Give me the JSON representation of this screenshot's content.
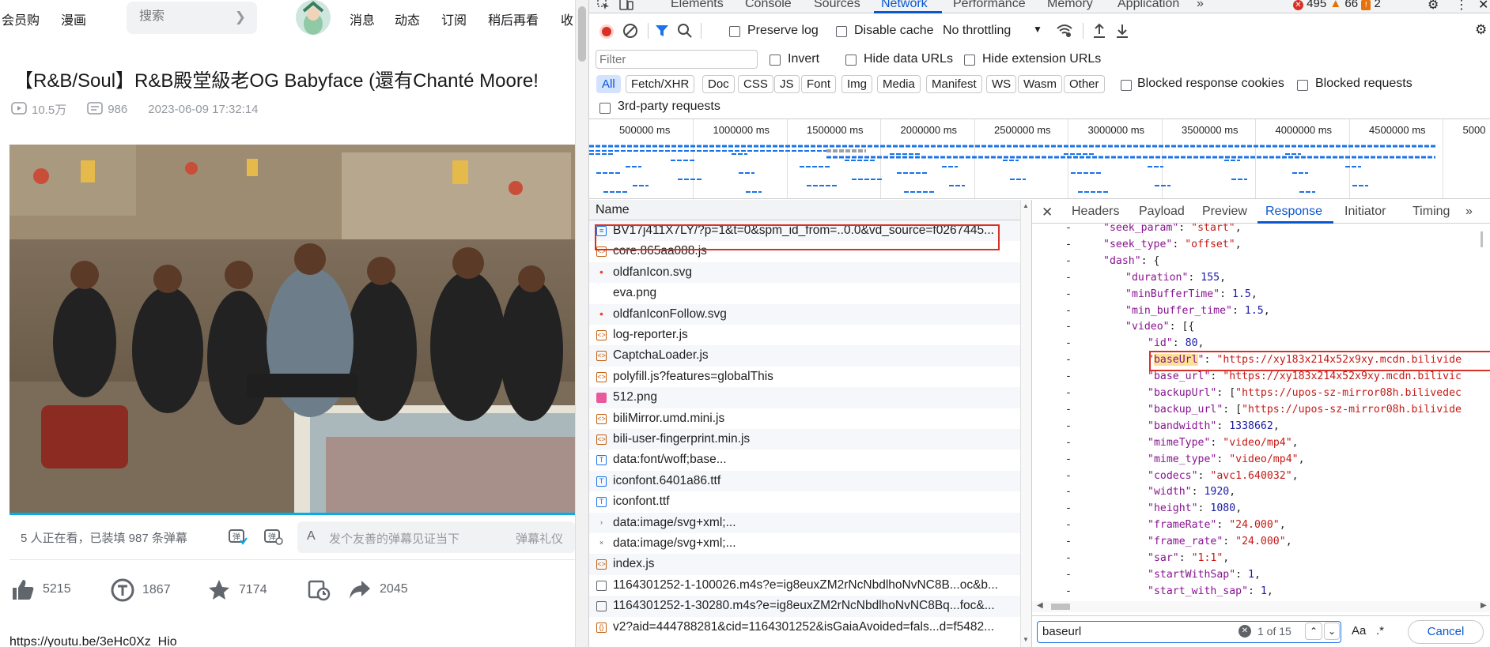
{
  "bili": {
    "nav": {
      "vip": "会员购",
      "comic": "漫画",
      "message": "消息",
      "dynamic": "动态",
      "subscribe": "订阅",
      "watch_later": "稍后再看",
      "fav": "收"
    },
    "search_placeholder": "搜索",
    "video": {
      "title": "【R&B/Soul】R&B殿堂級老OG Babyface (還有Chanté Moore!",
      "views": "10.5万",
      "danmaku_count": "986",
      "date": "2023-06-09 17:32:14"
    },
    "danmu_bar": {
      "watching": "5 人正在看，已装填 987 条弹幕",
      "input_placeholder": "发个友善的弹幕见证当下",
      "etiquette": "弹幕礼仪"
    },
    "actions": {
      "like": "5215",
      "coin": "1867",
      "fav": "7174",
      "share": "2045"
    },
    "desc_url": "https://youtu.be/3eHc0Xz_Hio"
  },
  "devtools": {
    "tabs": [
      "Elements",
      "Console",
      "Sources",
      "Network",
      "Performance",
      "Memory",
      "Application"
    ],
    "selected_tab": "Network",
    "counts": {
      "errors": "495",
      "warnings": "66",
      "issues": "2"
    },
    "toolbar": {
      "preserve_log": "Preserve log",
      "disable_cache": "Disable cache",
      "throttling": "No throttling"
    },
    "filter": {
      "placeholder": "Filter",
      "invert": "Invert",
      "hide_data": "Hide data URLs",
      "hide_ext": "Hide extension URLs"
    },
    "types": [
      "All",
      "Fetch/XHR",
      "Doc",
      "CSS",
      "JS",
      "Font",
      "Img",
      "Media",
      "Manifest",
      "WS",
      "Wasm",
      "Other"
    ],
    "blocked_cookies": "Blocked response cookies",
    "blocked_requests": "Blocked requests",
    "third_party": "3rd-party requests",
    "timeline_ticks": [
      "500000 ms",
      "1000000 ms",
      "1500000 ms",
      "2000000 ms",
      "2500000 ms",
      "3000000 ms",
      "3500000 ms",
      "4000000 ms",
      "4500000 ms",
      "5000"
    ],
    "name_header": "Name",
    "requests": [
      {
        "name": "BV17j411X7LY/?p=1&t=0&spm_id_from=..0.0&vd_source=f0267445...",
        "type": "doc"
      },
      {
        "name": "core.865aa088.js",
        "type": "js"
      },
      {
        "name": "oldfanIcon.svg",
        "type": "dot"
      },
      {
        "name": "eva.png",
        "type": "none"
      },
      {
        "name": "oldfanIconFollow.svg",
        "type": "dot"
      },
      {
        "name": "log-reporter.js",
        "type": "js"
      },
      {
        "name": "CaptchaLoader.js",
        "type": "js"
      },
      {
        "name": "polyfill.js?features=globalThis",
        "type": "js"
      },
      {
        "name": "512.png",
        "type": "img"
      },
      {
        "name": "biliMirror.umd.mini.js",
        "type": "js"
      },
      {
        "name": "bili-user-fingerprint.min.js",
        "type": "js"
      },
      {
        "name": "data:font/woff;base...",
        "type": "font"
      },
      {
        "name": "iconfont.6401a86.ttf",
        "type": "font"
      },
      {
        "name": "iconfont.ttf",
        "type": "font"
      },
      {
        "name": "data:image/svg+xml;...",
        "type": "chev"
      },
      {
        "name": "data:image/svg+xml;...",
        "type": "x"
      },
      {
        "name": "index.js",
        "type": "js"
      },
      {
        "name": "1164301252-1-100026.m4s?e=ig8euxZM2rNcNbdlhoNvNC8B...oc&b...",
        "type": "plain"
      },
      {
        "name": "1164301252-1-30280.m4s?e=ig8euxZM2rNcNbdlhoNvNC8Bq...foc&...",
        "type": "plain"
      },
      {
        "name": "v2?aid=444788281&cid=1164301252&isGaiaAvoided=fals...d=f5482...",
        "type": "xhr"
      }
    ],
    "detail_tabs": [
      "Headers",
      "Payload",
      "Preview",
      "Response",
      "Initiator",
      "Timing"
    ],
    "selected_detail": "Response",
    "code_lines": [
      {
        "indent": 3,
        "parts": [
          [
            "k",
            "\"seek_param\""
          ],
          [
            "p",
            ": "
          ],
          [
            "s",
            "\"start\""
          ],
          [
            "p",
            ","
          ]
        ]
      },
      {
        "indent": 3,
        "parts": [
          [
            "k",
            "\"seek_type\""
          ],
          [
            "p",
            ": "
          ],
          [
            "s",
            "\"offset\""
          ],
          [
            "p",
            ","
          ]
        ]
      },
      {
        "indent": 3,
        "parts": [
          [
            "k",
            "\"dash\""
          ],
          [
            "p",
            ": {"
          ]
        ]
      },
      {
        "indent": 4,
        "parts": [
          [
            "k",
            "\"duration\""
          ],
          [
            "p",
            ": "
          ],
          [
            "n",
            "155"
          ],
          [
            "p",
            ","
          ]
        ]
      },
      {
        "indent": 4,
        "parts": [
          [
            "k",
            "\"minBufferTime\""
          ],
          [
            "p",
            ": "
          ],
          [
            "n",
            "1.5"
          ],
          [
            "p",
            ","
          ]
        ]
      },
      {
        "indent": 4,
        "parts": [
          [
            "k",
            "\"min_buffer_time\""
          ],
          [
            "p",
            ": "
          ],
          [
            "n",
            "1.5"
          ],
          [
            "p",
            ","
          ]
        ]
      },
      {
        "indent": 4,
        "parts": [
          [
            "k",
            "\"video\""
          ],
          [
            "p",
            ": [{"
          ]
        ]
      },
      {
        "indent": 5,
        "parts": [
          [
            "k",
            "\"id\""
          ],
          [
            "p",
            ": "
          ],
          [
            "n",
            "80"
          ],
          [
            "p",
            ","
          ]
        ]
      },
      {
        "indent": 5,
        "parts": [
          [
            "k",
            "\""
          ],
          [
            "hl",
            "baseUrl"
          ],
          [
            "k",
            "\""
          ],
          [
            "p",
            ": "
          ],
          [
            "s",
            "\"https://xy183x214x52x9xy.mcdn.bilivide"
          ]
        ]
      },
      {
        "indent": 5,
        "parts": [
          [
            "k",
            "\"base_url\""
          ],
          [
            "p",
            ": "
          ],
          [
            "s",
            "\"https://xy183x214x52x9xy.mcdn.bilivic"
          ]
        ]
      },
      {
        "indent": 5,
        "parts": [
          [
            "k",
            "\"backupUrl\""
          ],
          [
            "p",
            ": ["
          ],
          [
            "s",
            "\"https://upos-sz-mirror08h.bilivedec"
          ]
        ]
      },
      {
        "indent": 5,
        "parts": [
          [
            "k",
            "\"backup_url\""
          ],
          [
            "p",
            ": ["
          ],
          [
            "s",
            "\"https://upos-sz-mirror08h.bilivide"
          ]
        ]
      },
      {
        "indent": 5,
        "parts": [
          [
            "k",
            "\"bandwidth\""
          ],
          [
            "p",
            ": "
          ],
          [
            "n",
            "1338662"
          ],
          [
            "p",
            ","
          ]
        ]
      },
      {
        "indent": 5,
        "parts": [
          [
            "k",
            "\"mimeType\""
          ],
          [
            "p",
            ": "
          ],
          [
            "s",
            "\"video/mp4\""
          ],
          [
            "p",
            ","
          ]
        ]
      },
      {
        "indent": 5,
        "parts": [
          [
            "k",
            "\"mime_type\""
          ],
          [
            "p",
            ": "
          ],
          [
            "s",
            "\"video/mp4\""
          ],
          [
            "p",
            ","
          ]
        ]
      },
      {
        "indent": 5,
        "parts": [
          [
            "k",
            "\"codecs\""
          ],
          [
            "p",
            ": "
          ],
          [
            "s",
            "\"avc1.640032\""
          ],
          [
            "p",
            ","
          ]
        ]
      },
      {
        "indent": 5,
        "parts": [
          [
            "k",
            "\"width\""
          ],
          [
            "p",
            ": "
          ],
          [
            "n",
            "1920"
          ],
          [
            "p",
            ","
          ]
        ]
      },
      {
        "indent": 5,
        "parts": [
          [
            "k",
            "\"height\""
          ],
          [
            "p",
            ": "
          ],
          [
            "n",
            "1080"
          ],
          [
            "p",
            ","
          ]
        ]
      },
      {
        "indent": 5,
        "parts": [
          [
            "k",
            "\"frameRate\""
          ],
          [
            "p",
            ": "
          ],
          [
            "s",
            "\"24.000\""
          ],
          [
            "p",
            ","
          ]
        ]
      },
      {
        "indent": 5,
        "parts": [
          [
            "k",
            "\"frame_rate\""
          ],
          [
            "p",
            ": "
          ],
          [
            "s",
            "\"24.000\""
          ],
          [
            "p",
            ","
          ]
        ]
      },
      {
        "indent": 5,
        "parts": [
          [
            "k",
            "\"sar\""
          ],
          [
            "p",
            ": "
          ],
          [
            "s",
            "\"1:1\""
          ],
          [
            "p",
            ","
          ]
        ]
      },
      {
        "indent": 5,
        "parts": [
          [
            "k",
            "\"startWithSap\""
          ],
          [
            "p",
            ": "
          ],
          [
            "n",
            "1"
          ],
          [
            "p",
            ","
          ]
        ]
      },
      {
        "indent": 5,
        "parts": [
          [
            "k",
            "\"start_with_sap\""
          ],
          [
            "p",
            ": "
          ],
          [
            "n",
            "1"
          ],
          [
            "p",
            ","
          ]
        ]
      }
    ],
    "search": {
      "value": "baseurl",
      "count": "1 of 15",
      "case": "Aa",
      "regex": ".*",
      "cancel": "Cancel"
    }
  }
}
